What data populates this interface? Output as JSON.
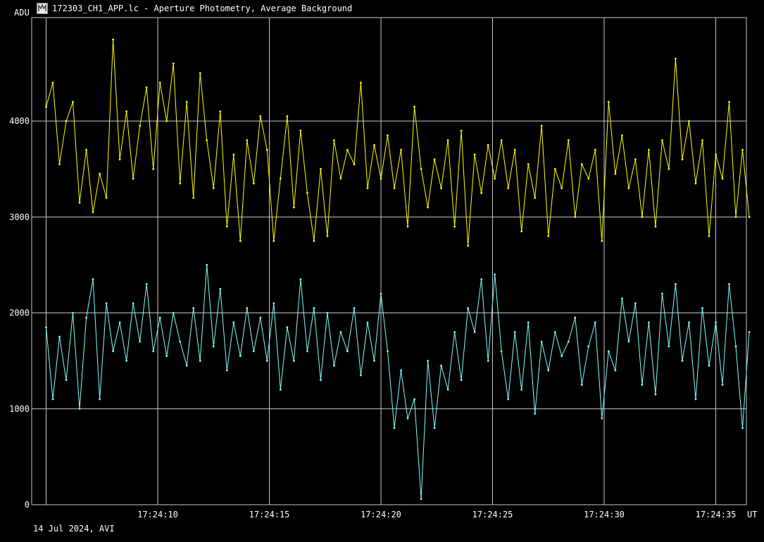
{
  "window": {
    "icon": "lightcurve-app-icon",
    "title": "172303_CH1_APP.lc - Aperture Photometry, Average Background"
  },
  "footer": {
    "date_label": "14 Jul 2024, AVI"
  },
  "colors": {
    "background": "#000000",
    "grid": "#c8c8c8",
    "series1": "#ffff00",
    "series2": "#80ffff",
    "text": "#ffffff"
  },
  "chart_data": {
    "type": "line",
    "title": "",
    "ylabel": "ADU",
    "xlabel": "UT",
    "ylim": [
      0,
      5000
    ],
    "yticks": [
      0,
      1000,
      2000,
      3000,
      4000
    ],
    "xticks": [
      "17:24:10",
      "17:24:15",
      "17:24:20",
      "17:24:25",
      "17:24:30",
      "17:24:35"
    ],
    "grid": true,
    "x_unit": "seconds after 17:24:05",
    "series": [
      {
        "color": "#ffff00",
        "x": [
          0,
          0.3,
          0.6,
          0.9,
          1.2,
          1.5,
          1.8,
          2.1,
          2.4,
          2.7,
          3.0,
          3.3,
          3.6,
          3.9,
          4.2,
          4.5,
          4.8,
          5.1,
          5.4,
          5.7,
          6.0,
          6.3,
          6.6,
          6.9,
          7.2,
          7.5,
          7.8,
          8.1,
          8.4,
          8.7,
          9.0,
          9.3,
          9.6,
          9.9,
          10.2,
          10.5,
          10.8,
          11.1,
          11.4,
          11.7,
          12.0,
          12.3,
          12.6,
          12.9,
          13.2,
          13.5,
          13.8,
          14.1,
          14.4,
          14.7,
          15.0,
          15.3,
          15.6,
          15.9,
          16.2,
          16.5,
          16.8,
          17.1,
          17.4,
          17.7,
          18.0,
          18.3,
          18.6,
          18.9,
          19.2,
          19.5,
          19.8,
          20.1,
          20.4,
          20.7,
          21.0,
          21.3,
          21.6,
          21.9,
          22.2,
          22.5,
          22.8,
          23.1,
          23.4,
          23.7,
          24.0,
          24.3,
          24.6,
          24.9,
          25.2,
          25.5,
          25.8,
          26.1,
          26.4,
          26.7,
          27.0,
          27.3,
          27.6,
          27.9,
          28.2,
          28.5,
          28.8,
          29.1,
          29.4,
          29.7,
          30.0,
          30.3,
          30.6,
          30.9,
          31.2,
          31.5
        ],
        "values": [
          4150,
          4400,
          3550,
          4000,
          4200,
          3150,
          3700,
          3050,
          3450,
          3200,
          4850,
          3600,
          4100,
          3400,
          3950,
          4350,
          3500,
          4400,
          4000,
          4600,
          3350,
          4200,
          3200,
          4500,
          3800,
          3300,
          4100,
          2900,
          3650,
          2750,
          3800,
          3350,
          4050,
          3700,
          2750,
          3400,
          4050,
          3100,
          3900,
          3250,
          2750,
          3500,
          2800,
          3800,
          3400,
          3700,
          3550,
          4400,
          3300,
          3750,
          3400,
          3850,
          3300,
          3700,
          2900,
          4150,
          3500,
          3100,
          3600,
          3300,
          3800,
          2900,
          3900,
          2700,
          3650,
          3250,
          3750,
          3400,
          3800,
          3300,
          3700,
          2850,
          3550,
          3200,
          3950,
          2800,
          3500,
          3300,
          3800,
          3000,
          3550,
          3400,
          3700,
          2750,
          4200,
          3450,
          3850,
          3300,
          3600,
          3000,
          3700,
          2900,
          3800,
          3500,
          4650,
          3600,
          4000,
          3350,
          3800,
          2800,
          3650,
          3400,
          4200,
          3000,
          3700,
          3000
        ]
      },
      {
        "color": "#80ffff",
        "x": [
          0,
          0.3,
          0.6,
          0.9,
          1.2,
          1.5,
          1.8,
          2.1,
          2.4,
          2.7,
          3.0,
          3.3,
          3.6,
          3.9,
          4.2,
          4.5,
          4.8,
          5.1,
          5.4,
          5.7,
          6.0,
          6.3,
          6.6,
          6.9,
          7.2,
          7.5,
          7.8,
          8.1,
          8.4,
          8.7,
          9.0,
          9.3,
          9.6,
          9.9,
          10.2,
          10.5,
          10.8,
          11.1,
          11.4,
          11.7,
          12.0,
          12.3,
          12.6,
          12.9,
          13.2,
          13.5,
          13.8,
          14.1,
          14.4,
          14.7,
          15.0,
          15.3,
          15.6,
          15.9,
          16.2,
          16.5,
          16.8,
          17.1,
          17.4,
          17.7,
          18.0,
          18.3,
          18.6,
          18.9,
          19.2,
          19.5,
          19.8,
          20.1,
          20.4,
          20.7,
          21.0,
          21.3,
          21.6,
          21.9,
          22.2,
          22.5,
          22.8,
          23.1,
          23.4,
          23.7,
          24.0,
          24.3,
          24.6,
          24.9,
          25.2,
          25.5,
          25.8,
          26.1,
          26.4,
          26.7,
          27.0,
          27.3,
          27.6,
          27.9,
          28.2,
          28.5,
          28.8,
          29.1,
          29.4,
          29.7,
          30.0,
          30.3,
          30.6,
          30.9,
          31.2,
          31.5
        ],
        "values": [
          1850,
          1100,
          1750,
          1300,
          2000,
          1000,
          1950,
          2350,
          1100,
          2100,
          1600,
          1900,
          1500,
          2100,
          1700,
          2300,
          1600,
          1950,
          1550,
          2000,
          1700,
          1450,
          2050,
          1500,
          2500,
          1650,
          2250,
          1400,
          1900,
          1550,
          2050,
          1600,
          1950,
          1500,
          2100,
          1200,
          1850,
          1500,
          2350,
          1600,
          2050,
          1300,
          2000,
          1450,
          1800,
          1600,
          2050,
          1350,
          1900,
          1500,
          2200,
          1600,
          800,
          1400,
          900,
          1100,
          60,
          1500,
          800,
          1450,
          1200,
          1800,
          1300,
          2050,
          1800,
          2350,
          1500,
          2400,
          1600,
          1100,
          1800,
          1200,
          1900,
          950,
          1700,
          1400,
          1800,
          1550,
          1700,
          1950,
          1250,
          1650,
          1900,
          900,
          1600,
          1400,
          2150,
          1700,
          2100,
          1250,
          1900,
          1150,
          2200,
          1650,
          2300,
          1500,
          1900,
          1100,
          2050,
          1450,
          1900,
          1250,
          2300,
          1650,
          800,
          1800
        ]
      }
    ]
  }
}
